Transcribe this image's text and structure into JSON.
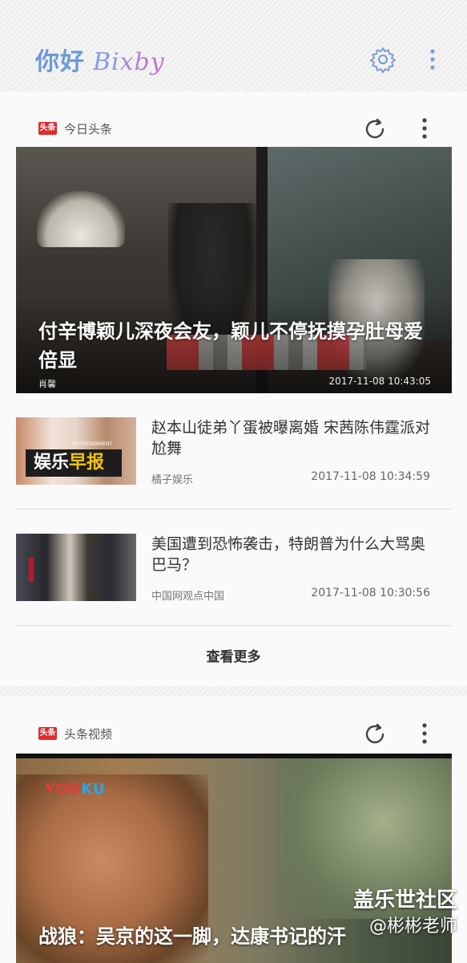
{
  "header": {
    "greeting": "你好",
    "brand": "Bixby",
    "settings_icon": "gear-icon",
    "menu_icon": "more-vertical-icon"
  },
  "cards": [
    {
      "source": "今日头条",
      "logo_text": "头条",
      "hero": {
        "title": "付辛博颖儿深夜会友，颖儿不停抚摸孕肚母爱倍显",
        "source": "肖馨",
        "time": "2017-11-08 10:43:05"
      },
      "items": [
        {
          "title": "赵本山徒弟丫蛋被曝离婚 宋茜陈伟霆派对尬舞",
          "source": "橘子娱乐",
          "time": "2017-11-08 10:34:59",
          "thumb_banner": "娱乐",
          "thumb_banner_accent": "早报",
          "thumb_caption": "ENTERTAINMENT"
        },
        {
          "title": "美国遭到恐怖袭击，特朗普为什么大骂奥巴马？",
          "source": "中国网观点中国",
          "time": "2017-11-08 10:30:56"
        }
      ],
      "more_label": "查看更多"
    },
    {
      "source": "头条视频",
      "logo_text": "头条",
      "video": {
        "brand": "YOU",
        "brand_accent": "KU",
        "title": "战狼：吴京的这一脚，达康书记的汗"
      }
    }
  ],
  "watermark": {
    "line1": "盖乐世社区",
    "line2": "@彬彬老师"
  },
  "colors": {
    "brand_start": "#7aa2e6",
    "brand_end": "#d36cc9",
    "logo_red": "#e02a2a"
  }
}
